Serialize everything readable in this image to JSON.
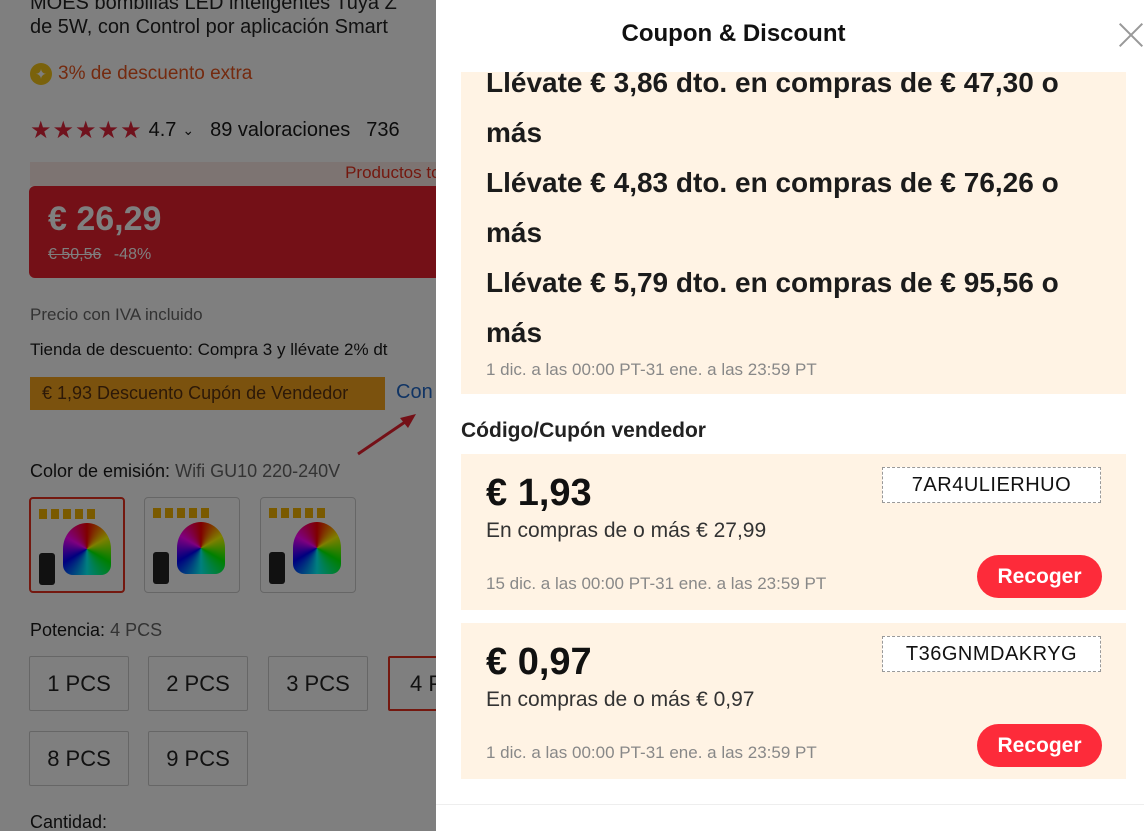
{
  "product": {
    "title_line1": "MOES bombillas LED inteligentes Tuya Z",
    "title_line2": "de 5W, con Control por aplicación Smart",
    "extra_discount": "3% de descuento extra",
    "rating_value": "4.7",
    "rating_count": "89 valoraciones",
    "sold_fragment": "736",
    "top_products_label": "Productos top",
    "price": "€ 26,29",
    "old_price": "€ 50,56",
    "discount_pct": "-48%",
    "vat_note": "Precio con IVA incluido",
    "store_discount": "Tienda de descuento: Compra 3 y llévate 2% dt",
    "seller_coupon_tag": "€ 1,93 Descuento Cupón de Vendedor",
    "coupon_more_link": "Con",
    "color_label": "Color de emisión:",
    "color_value": "Wifi GU10 220-240V",
    "power_label": "Potencia:",
    "power_value": "4 PCS",
    "power_options": [
      "1 PCS",
      "2 PCS",
      "3 PCS",
      "4 P",
      "8 PCS",
      "9 PCS"
    ],
    "quantity_label": "Cantidad:"
  },
  "drawer": {
    "title": "Coupon & Discount",
    "store_tiers": [
      "Llévate € 3,86 dto. en compras de € 47,30 o",
      "más",
      "Llévate € 4,83 dto. en compras de € 76,26 o",
      "más",
      "Llévate € 5,79 dto. en compras de € 95,56 o",
      "más"
    ],
    "store_tiers_date": "1 dic. a las 00:00 PT-31 ene. a las 23:59 PT",
    "seller_section_label": "Código/Cupón vendedor",
    "vouchers": [
      {
        "amount": "€ 1,93",
        "min": "En compras de o más € 27,99",
        "date": "15 dic. a las 00:00 PT-31 ene. a las 23:59 PT",
        "code": "7AR4ULIERHUO",
        "button": "Recoger"
      },
      {
        "amount": "€ 0,97",
        "min": "En compras de o más € 0,97",
        "date": "1 dic. a las 00:00 PT-31 ene. a las 23:59 PT",
        "code": "T36GNMDAKRYG",
        "button": "Recoger"
      }
    ]
  },
  "colors": {
    "accent_red": "#fd2b3a",
    "card_bg": "#fff3e4",
    "coupon_tag_bg": "#f7a51c",
    "price_bg": "#e8202e"
  }
}
